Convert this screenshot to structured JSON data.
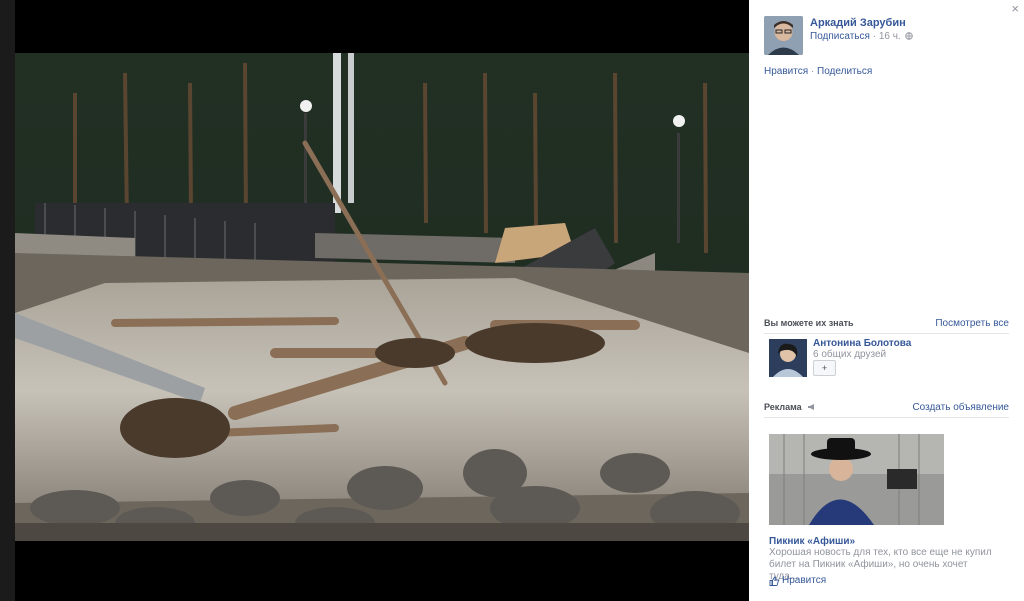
{
  "sidebar": {
    "close_label": "×",
    "author": {
      "name": "Аркадий Зарубин",
      "subscribe": "Подписаться",
      "separator": " · ",
      "time": "16 ч.",
      "privacy_icon": "globe-icon"
    },
    "actions": {
      "like": "Нравится",
      "separator": " · ",
      "share": "Поделиться"
    },
    "people_section": {
      "title": "Вы можете их знать",
      "see_all": "Посмотреть все",
      "friend": {
        "name": "Антонина Болотова",
        "mutual": "6 общих друзей",
        "add_label": "+",
        "add_icon": "add-friend-icon"
      }
    },
    "ads_section": {
      "title": "Реклама",
      "create": "Создать объявление",
      "ad": {
        "title": "Пикник «Афиши»",
        "description": "Хорошая новость для тех, кто все еще не купил билет на Пикник «Афиши», но очень хочет туда...",
        "like": "Нравится",
        "like_icon": "thumbs-up-icon"
      }
    }
  },
  "colors": {
    "link": "#365899",
    "muted": "#90949c",
    "background": "#ffffff",
    "stage": "#000000"
  }
}
